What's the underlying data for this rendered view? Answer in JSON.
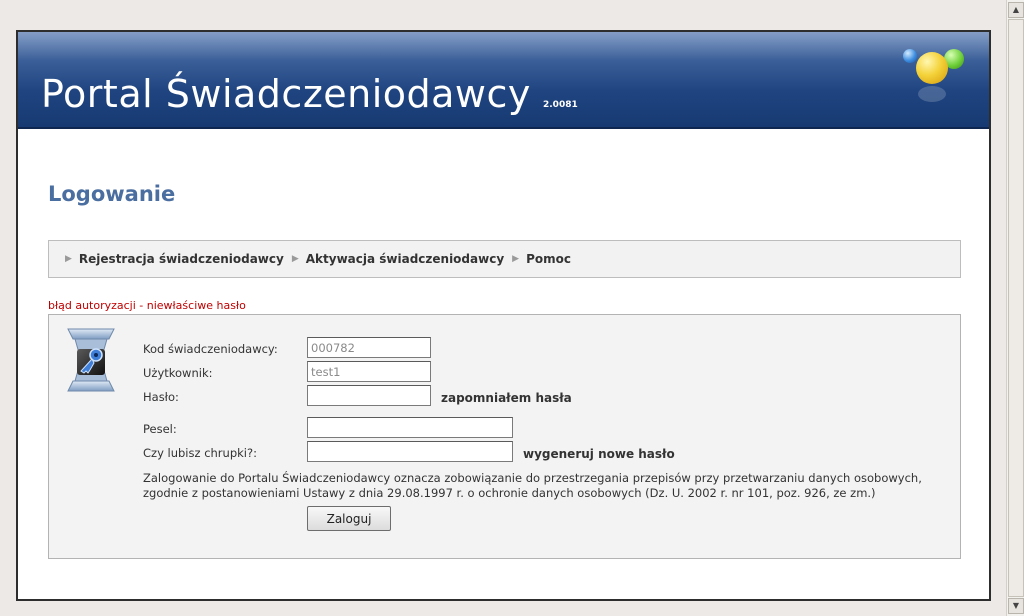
{
  "header": {
    "title": "Portal Świadczeniodawcy",
    "version": "2.0081"
  },
  "page": {
    "title": "Logowanie"
  },
  "nav": {
    "items": [
      {
        "label": "Rejestracja świadczeniodawcy"
      },
      {
        "label": "Aktywacja świadczeniodawcy"
      },
      {
        "label": "Pomoc"
      }
    ]
  },
  "error": "błąd autoryzacji - niewłaściwe hasło",
  "form": {
    "provider_code": {
      "label": "Kod świadczeniodawcy:",
      "value": "000782"
    },
    "user": {
      "label": "Użytkownik:",
      "value": "test1"
    },
    "password": {
      "label": "Hasło:",
      "value": ""
    },
    "forgot_link": "zapomniałem hasła",
    "pesel": {
      "label": "Pesel:",
      "value": ""
    },
    "captcha": {
      "label": "Czy lubisz chrupki?:",
      "value": ""
    },
    "new_password_link": "wygeneruj nowe hasło",
    "notice": "Zalogowanie do Portalu Świadczeniodawcy oznacza zobowiązanie do przestrzegania przepisów przy przetwarzaniu danych osobowych, zgodnie z postanowieniami Ustawy z dnia 29.08.1997 r. o ochronie danych osobowych (Dz. U. 2002 r. nr 101, poz. 926, ze zm.)",
    "submit_label": "Zaloguj"
  },
  "colors": {
    "banner": "#1f4480",
    "title": "#4a6ea0",
    "error": "#c00000"
  },
  "icons": {
    "logo": "colored-balls-icon",
    "login": "key-icon",
    "nav_arrow": "triangle-right-icon"
  }
}
